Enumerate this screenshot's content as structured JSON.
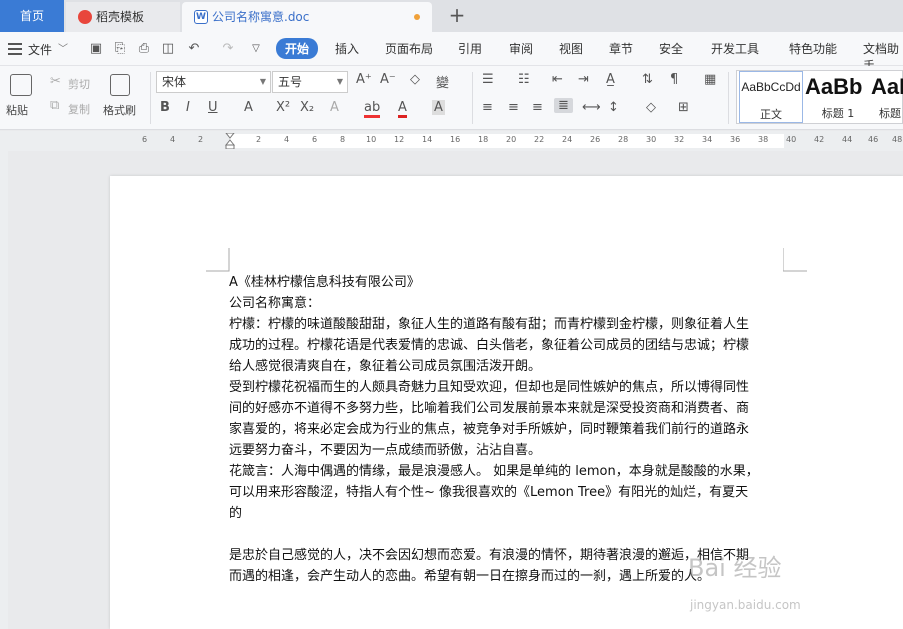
{
  "tabs": {
    "home": "首页",
    "templates": "稻壳模板",
    "document": "公司名称寓意.doc"
  },
  "menu": {
    "file": "文件",
    "ribbon_tabs": [
      "开始",
      "插入",
      "页面布局",
      "引用",
      "审阅",
      "视图",
      "章节",
      "安全",
      "开发工具",
      "特色功能",
      "文档助手"
    ]
  },
  "toolbar": {
    "paste": "粘贴",
    "cut": "剪切",
    "copy": "复制",
    "format_painter": "格式刷",
    "font_name": "宋体",
    "font_size": "五号"
  },
  "styles": {
    "normal_preview": "AaBbCcDd",
    "normal_name": "正文",
    "heading1_preview": "AaBb",
    "heading1_name": "标题 1",
    "heading2_preview": "AaB",
    "heading2_name": "标题"
  },
  "ruler": {
    "h_numbers": [
      "6",
      "4",
      "2",
      "2",
      "4",
      "6",
      "8",
      "10",
      "12",
      "14",
      "16",
      "18",
      "20",
      "22",
      "24",
      "26",
      "28",
      "30",
      "32",
      "34",
      "36",
      "38",
      "40",
      "42",
      "44",
      "46",
      "48"
    ]
  },
  "document": {
    "lines": [
      "A《桂林柠檬信息科技有限公司》",
      "公司名称寓意：",
      "柠檬：柠檬的味道酸酸甜甜，象征人生的道路有酸有甜；而青柠檬到金柠檬，则象征着人生",
      "成功的过程。柠檬花语是代表爱情的忠诚、白头偕老，象征着公司成员的团结与忠诚；柠檬",
      "给人感觉很清爽自在，象征着公司成员氛围活泼开朗。",
      "受到柠檬花祝福而生的人颇具奇魅力且知受欢迎，但却也是同性嫉妒的焦点，所以博得同性",
      "间的好感亦不道得不多努力些，比喻着我们公司发展前景本来就是深受投资商和消费者、商",
      "家喜爱的，将来必定会成为行业的焦点，被竞争对手所嫉妒，同时鞭策着我们前行的道路永",
      "远要努力奋斗，不要因为一点成绩而骄傲，沾沾自喜。",
      "花箴言：人海中偶遇的情缘，最是浪漫感人。 如果是单纯的 lemon，本身就是酸酸的水果，",
      "可以用来形容酸涩，特指人有个性~ 像我很喜欢的《Lemon Tree》有阳光的灿烂，有夏天",
      "的",
      "",
      "是忠於自己感觉的人，决不会因幻想而恋爱。有浪漫的情怀，期待著浪漫的邂逅，相信不期",
      "而遇的相逢，会产生动人的恋曲。希望有朝一日在擦身而过的一刹，遇上所爱的人。"
    ]
  },
  "watermark": {
    "text": "Bai 经验",
    "url": "jingyan.baidu.com"
  }
}
